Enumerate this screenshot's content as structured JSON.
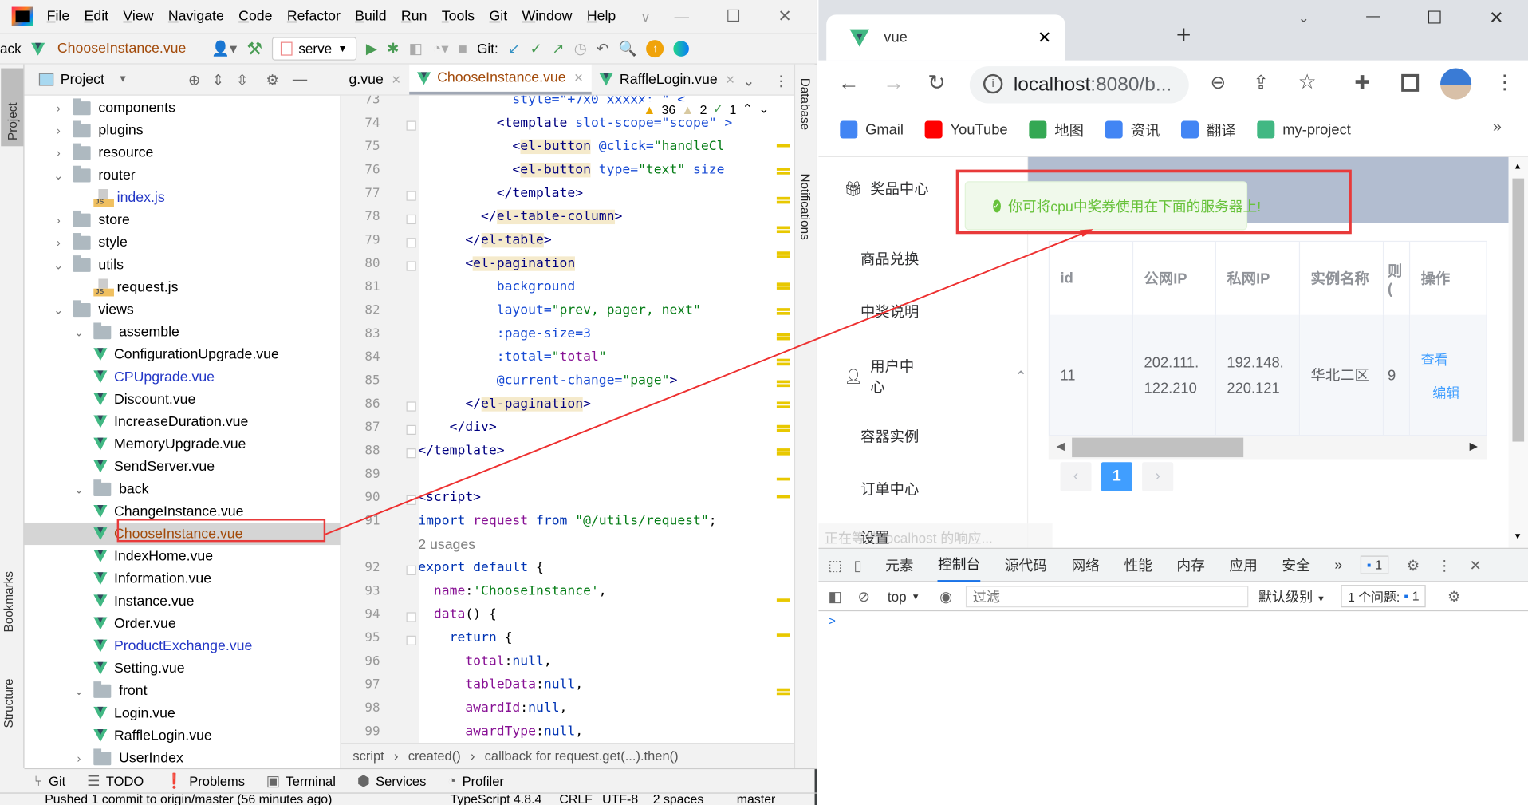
{
  "ide": {
    "menu": [
      "File",
      "Edit",
      "View",
      "Navigate",
      "Code",
      "Refactor",
      "Build",
      "Run",
      "Tools",
      "Git",
      "Window",
      "Help"
    ],
    "menu_extra": "v",
    "toolbar": {
      "nav_back": "ack",
      "current_file": "ChooseInstance.vue",
      "run_config": "serve",
      "git_label": "Git:"
    },
    "left_stripe": [
      "Project",
      "Bookmarks",
      "Structure"
    ],
    "right_stripe": [
      "Database",
      "Notifications"
    ],
    "project_panel_title": "Project",
    "tree": [
      {
        "label": "components",
        "type": "folder",
        "depth": 1,
        "expanded": false
      },
      {
        "label": "plugins",
        "type": "folder",
        "depth": 1,
        "expanded": false
      },
      {
        "label": "resource",
        "type": "folder",
        "depth": 1,
        "expanded": false
      },
      {
        "label": "router",
        "type": "folder",
        "depth": 1,
        "expanded": true
      },
      {
        "label": "index.js",
        "type": "js",
        "depth": 2,
        "color": "blue"
      },
      {
        "label": "store",
        "type": "folder",
        "depth": 1,
        "expanded": false
      },
      {
        "label": "style",
        "type": "folder",
        "depth": 1,
        "expanded": false
      },
      {
        "label": "utils",
        "type": "folder",
        "depth": 1,
        "expanded": true
      },
      {
        "label": "request.js",
        "type": "js",
        "depth": 2
      },
      {
        "label": "views",
        "type": "folder",
        "depth": 1,
        "expanded": true
      },
      {
        "label": "assemble",
        "type": "folder",
        "depth": 2,
        "expanded": true
      },
      {
        "label": "ConfigurationUpgrade.vue",
        "type": "vue",
        "depth": 3
      },
      {
        "label": "CPUpgrade.vue",
        "type": "vue",
        "depth": 3,
        "color": "blue"
      },
      {
        "label": "Discount.vue",
        "type": "vue",
        "depth": 3
      },
      {
        "label": "IncreaseDuration.vue",
        "type": "vue",
        "depth": 3
      },
      {
        "label": "MemoryUpgrade.vue",
        "type": "vue",
        "depth": 3
      },
      {
        "label": "SendServer.vue",
        "type": "vue",
        "depth": 3
      },
      {
        "label": "back",
        "type": "folder",
        "depth": 2,
        "expanded": true
      },
      {
        "label": "ChangeInstance.vue",
        "type": "vue",
        "depth": 3
      },
      {
        "label": "ChooseInstance.vue",
        "type": "vue",
        "depth": 3,
        "color": "brown",
        "selected": true
      },
      {
        "label": "IndexHome.vue",
        "type": "vue",
        "depth": 3
      },
      {
        "label": "Information.vue",
        "type": "vue",
        "depth": 3
      },
      {
        "label": "Instance.vue",
        "type": "vue",
        "depth": 3
      },
      {
        "label": "Order.vue",
        "type": "vue",
        "depth": 3
      },
      {
        "label": "ProductExchange.vue",
        "type": "vue",
        "depth": 3,
        "color": "blue"
      },
      {
        "label": "Setting.vue",
        "type": "vue",
        "depth": 3
      },
      {
        "label": "front",
        "type": "folder",
        "depth": 2,
        "expanded": true
      },
      {
        "label": "Login.vue",
        "type": "vue",
        "depth": 3
      },
      {
        "label": "RaffleLogin.vue",
        "type": "vue",
        "depth": 3
      },
      {
        "label": "UserIndex",
        "type": "folder",
        "depth": 2,
        "expanded": false
      }
    ],
    "editor_tabs": [
      {
        "label": "g.vue"
      },
      {
        "label": "ChooseInstance.vue",
        "active": true
      },
      {
        "label": "RaffleLogin.vue"
      }
    ],
    "inspections": {
      "warnings": "36",
      "weak_warnings": "2",
      "typos": "1"
    },
    "code": [
      {
        "n": "73",
        "t": [
          [
            "            style=\"+7x0 xxxxx; \" <",
            "t-attr"
          ]
        ]
      },
      {
        "n": "74",
        "t": [
          [
            "          <",
            "t-tag"
          ],
          [
            "template",
            "t-tag"
          ],
          [
            " slot-scope=\"scope\" >",
            "t-attr"
          ]
        ]
      },
      {
        "n": "75",
        "t": [
          [
            "            <",
            "t-tag"
          ],
          [
            "el-button",
            "t-tag t-hl"
          ],
          [
            " @click=",
            "t-attr"
          ],
          [
            "\"handleCl",
            "t-str"
          ]
        ]
      },
      {
        "n": "76",
        "t": [
          [
            "            <",
            "t-tag"
          ],
          [
            "el-button",
            "t-tag t-hl"
          ],
          [
            " type=",
            "t-attr"
          ],
          [
            "\"text\"",
            "t-str"
          ],
          [
            " size",
            "t-attr"
          ]
        ]
      },
      {
        "n": "77",
        "t": [
          [
            "          </template>",
            "t-tag"
          ]
        ]
      },
      {
        "n": "78",
        "t": [
          [
            "        </",
            "t-tag"
          ],
          [
            "el-table-column",
            "t-tag t-hl"
          ],
          [
            ">",
            "t-tag"
          ]
        ]
      },
      {
        "n": "79",
        "t": [
          [
            "      </",
            "t-tag"
          ],
          [
            "el-table",
            "t-tag t-hl"
          ],
          [
            ">",
            "t-tag"
          ]
        ]
      },
      {
        "n": "80",
        "t": [
          [
            "      <",
            "t-tag"
          ],
          [
            "el-pagination",
            "t-tag t-hl"
          ]
        ]
      },
      {
        "n": "81",
        "t": [
          [
            "          background",
            "t-attr"
          ]
        ]
      },
      {
        "n": "82",
        "t": [
          [
            "          layout=",
            "t-attr"
          ],
          [
            "\"prev, pager, next\"",
            "t-str"
          ]
        ]
      },
      {
        "n": "83",
        "t": [
          [
            "          :page-size=",
            "t-attr"
          ],
          [
            "3",
            "t-num"
          ]
        ]
      },
      {
        "n": "84",
        "t": [
          [
            "          :total=",
            "t-attr"
          ],
          [
            "\"",
            "t-str"
          ],
          [
            "total",
            "t-prop"
          ],
          [
            "\"",
            "t-str"
          ]
        ]
      },
      {
        "n": "85",
        "t": [
          [
            "          @current-change=",
            "t-attr"
          ],
          [
            "\"page\"",
            "t-str"
          ],
          [
            ">",
            "t-tag"
          ]
        ]
      },
      {
        "n": "86",
        "t": [
          [
            "      </",
            "t-tag"
          ],
          [
            "el-pagination",
            "t-tag t-hl"
          ],
          [
            ">",
            "t-tag"
          ]
        ]
      },
      {
        "n": "87",
        "t": [
          [
            "    </div>",
            "t-tag"
          ]
        ]
      },
      {
        "n": "88",
        "t": [
          [
            "</template>",
            "t-tag"
          ]
        ]
      },
      {
        "n": "89",
        "t": []
      },
      {
        "n": "90",
        "t": [
          [
            "<script>",
            "t-tag"
          ]
        ]
      },
      {
        "n": "91",
        "t": [
          [
            "import ",
            "t-kw"
          ],
          [
            "request ",
            "t-prop"
          ],
          [
            "from ",
            "t-kw"
          ],
          [
            "\"@/utils/request\"",
            "t-str"
          ],
          [
            ";",
            ""
          ]
        ]
      },
      {
        "n": "",
        "t": [
          [
            "2 usages",
            "t-hint"
          ]
        ]
      },
      {
        "n": "92",
        "t": [
          [
            "export default ",
            "t-kw"
          ],
          [
            "{",
            ""
          ]
        ]
      },
      {
        "n": "93",
        "t": [
          [
            "  name",
            "t-prop"
          ],
          [
            ":",
            ""
          ],
          [
            "'ChooseInstance'",
            "t-str"
          ],
          [
            ",",
            ""
          ]
        ]
      },
      {
        "n": "94",
        "t": [
          [
            "  data",
            "t-prop"
          ],
          [
            "() {",
            ""
          ]
        ]
      },
      {
        "n": "95",
        "t": [
          [
            "    return ",
            "t-kw"
          ],
          [
            "{",
            ""
          ]
        ]
      },
      {
        "n": "96",
        "t": [
          [
            "      total",
            "t-prop"
          ],
          [
            ":",
            ""
          ],
          [
            "null",
            "t-kw"
          ],
          [
            ",",
            ""
          ]
        ]
      },
      {
        "n": "97",
        "t": [
          [
            "      tableData",
            "t-prop"
          ],
          [
            ":",
            ""
          ],
          [
            "null",
            "t-kw"
          ],
          [
            ",",
            ""
          ]
        ]
      },
      {
        "n": "98",
        "t": [
          [
            "      awardId",
            "t-prop"
          ],
          [
            ":",
            ""
          ],
          [
            "null",
            "t-kw"
          ],
          [
            ",",
            ""
          ]
        ]
      },
      {
        "n": "99",
        "t": [
          [
            "      awardType",
            "t-prop"
          ],
          [
            ":",
            ""
          ],
          [
            "null",
            "t-kw"
          ],
          [
            ",",
            ""
          ]
        ]
      }
    ],
    "breadcrumb": [
      "script",
      "created()",
      "callback for request.get(...).then()"
    ],
    "bottom_tools": [
      "Git",
      "TODO",
      "Problems",
      "Terminal",
      "Services",
      "Profiler"
    ],
    "status": {
      "message": "Pushed 1 commit to origin/master (56 minutes ago)",
      "language": "TypeScript 4.8.4",
      "line_sep": "CRLF",
      "encoding": "UTF-8",
      "indent": "2 spaces",
      "branch": "master"
    }
  },
  "browser": {
    "tab_title": "vue",
    "url_host": "localhost",
    "url_rest": ":8080/b...",
    "bookmarks": [
      "Gmail",
      "YouTube",
      "地图",
      "资讯",
      "翻译",
      "my-project"
    ],
    "sidebar": [
      {
        "label": "奖品中心",
        "icon": "gift-icon"
      },
      {
        "label": "商品兑换"
      },
      {
        "label": "中奖说明"
      },
      {
        "label": "用户中心",
        "icon": "user-icon",
        "expanded": true
      },
      {
        "label": "容器实例"
      },
      {
        "label": "订单中心"
      },
      {
        "label": "设置"
      }
    ],
    "loading_text": "正在等待 localhost 的响应...",
    "toast": "你可将cpu中奖券使用在下面的服务器上!",
    "table": {
      "headers": [
        "id",
        "公网IP",
        "私网IP",
        "实例名称",
        "则\n(",
        "操作"
      ],
      "row": {
        "id": "11",
        "public_ip": "202.111.\n122.210",
        "private_ip": "192.148.\n220.121",
        "name": "华北二区",
        "col5": "9",
        "view": "查看",
        "edit": "编辑"
      }
    },
    "pagination": {
      "current": "1"
    },
    "devtools": {
      "tabs": [
        "元素",
        "控制台",
        "源代码",
        "网络",
        "性能",
        "内存",
        "应用",
        "安全"
      ],
      "active_tab": "控制台",
      "messages_badge": "1",
      "context": "top",
      "filter_placeholder": "过滤",
      "level": "默认级别",
      "issues": "1 个问题:",
      "issues_count": "1",
      "prompt": ">"
    },
    "colors": {
      "accent": "#409eff",
      "success": "#67c23a",
      "annotation": "#e83a3a"
    }
  }
}
